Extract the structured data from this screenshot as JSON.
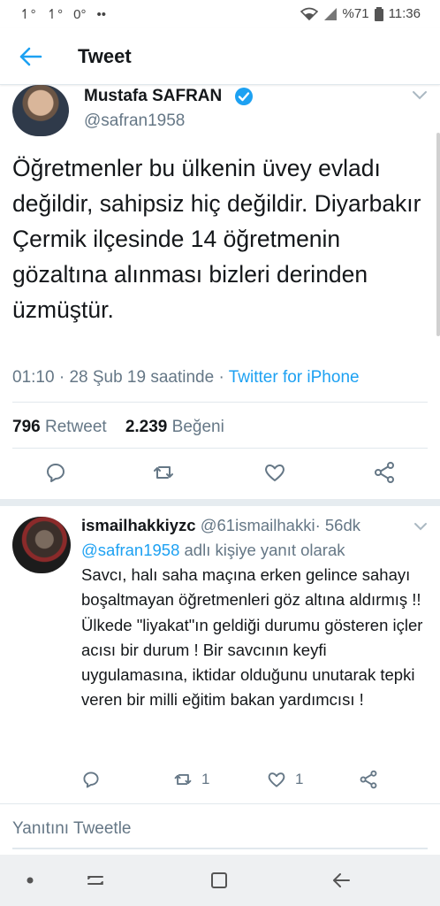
{
  "status_bar": {
    "left_icons": [
      "network-arrow-icon",
      "network-arrow-icon",
      "degree-icon",
      "dots-icon"
    ],
    "battery_percent": "%71",
    "time": "11:36"
  },
  "app_bar": {
    "title": "Tweet"
  },
  "tweet": {
    "author_name": "Mustafa SAFRAN",
    "author_handle": "@safran1958",
    "text": "Öğretmenler bu ülkenin üvey evladı değildir, sahipsiz hiç değildir. Diyarbakır Çermik ilçesinde 14 öğretmenin gözaltına alınması bizleri derinden üzmüştür.",
    "time": "01:10",
    "date": "28 Şub 19 saatinde",
    "separator": "·",
    "source": "Twitter for iPhone",
    "retweet_count": "796",
    "retweet_label": "Retweet",
    "like_count": "2.239",
    "like_label": "Beğeni",
    "accent_color": "#1da1f2"
  },
  "reply": {
    "author_name": "ismailhakkiyzc",
    "author_handle": "@61ismailhakki",
    "age": "56dk",
    "separator": "·",
    "replying_to": "@safran1958",
    "replying_suffix": "adlı kişiye yanıt olarak",
    "text": "Savcı, halı saha maçına erken gelince sahayı boşaltmayan öğretmenleri göz altına aldırmış !! Ülkede \"liyakat\"ın geldiği durumu gösteren içler acısı bir durum ! Bir savcının keyfi uygulamasına, iktidar olduğunu unutarak tepki veren bir milli eğitim bakan yardımcısı !",
    "retweet_count": "1",
    "like_count": "1"
  },
  "compose": {
    "placeholder": "Yanıtını Tweetle"
  },
  "nav_bar": {
    "buttons": [
      "nav-dot-icon",
      "recent-apps-icon",
      "home-icon",
      "back-icon"
    ]
  }
}
